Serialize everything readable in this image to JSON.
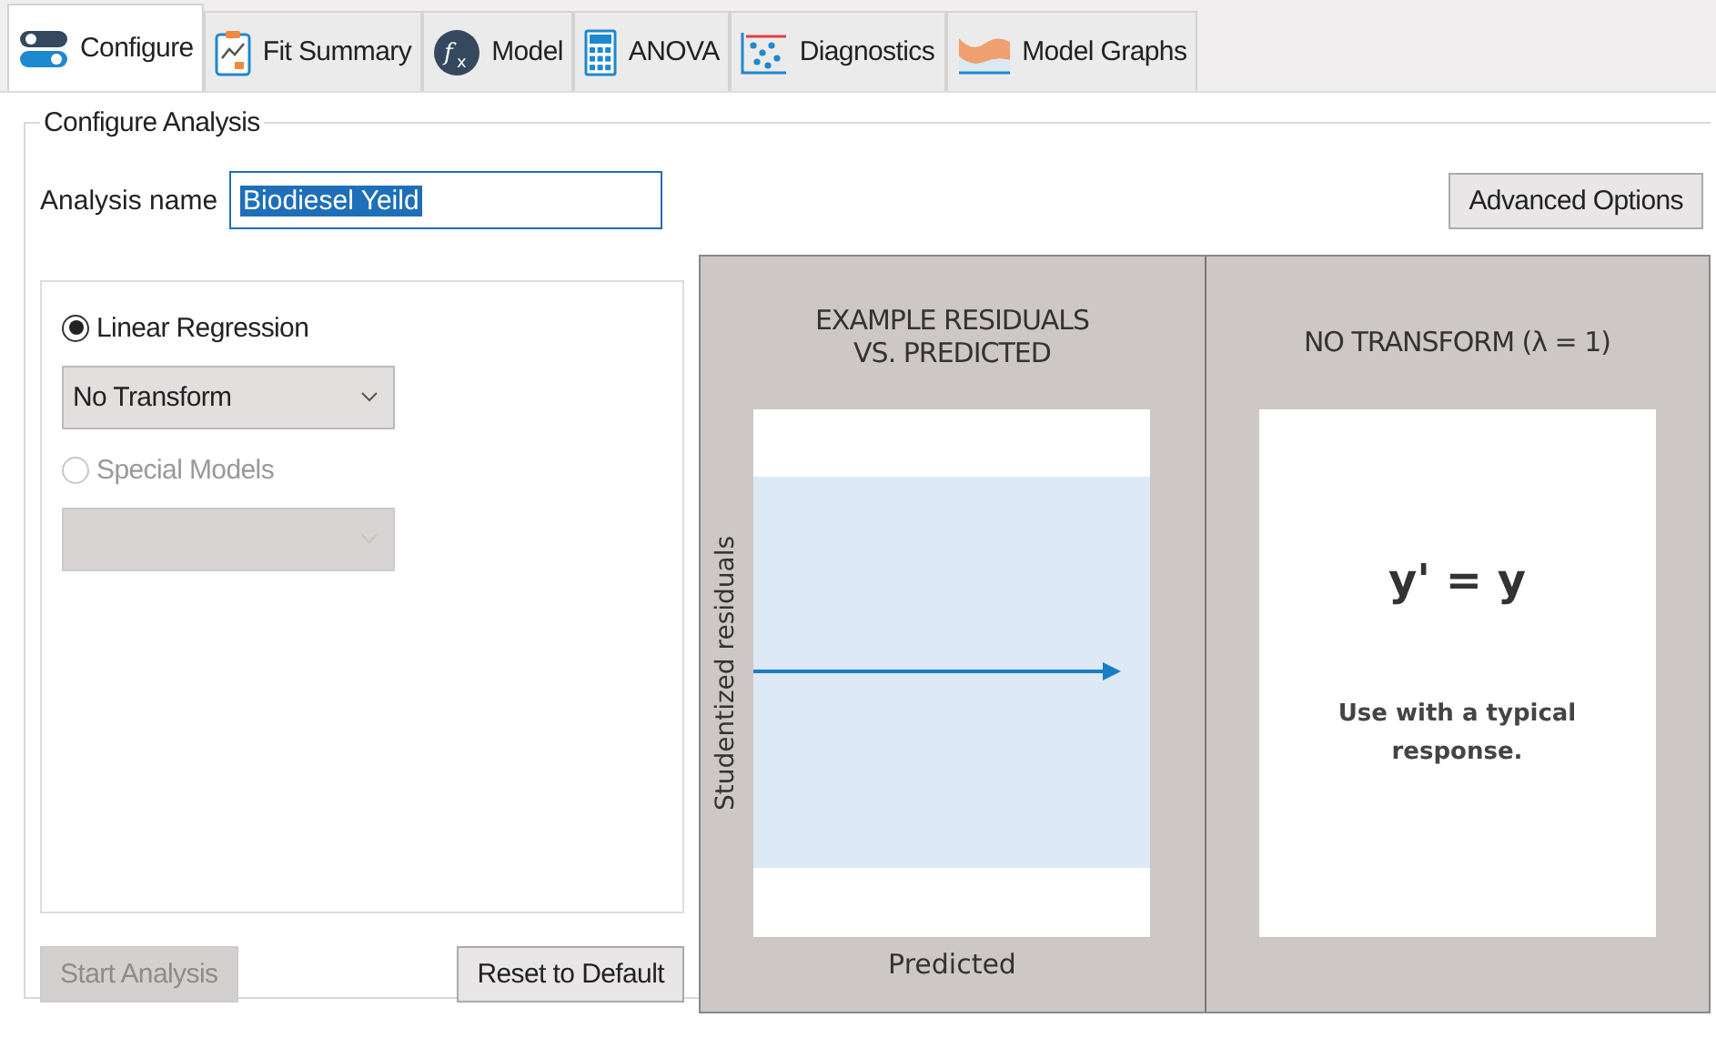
{
  "tabs": [
    {
      "label": "Configure",
      "kind": "toggle",
      "selected": true
    },
    {
      "label": "Fit Summary",
      "kind": "clipboard",
      "selected": false
    },
    {
      "label": "Model",
      "kind": "fx",
      "selected": false
    },
    {
      "label": "ANOVA",
      "kind": "calculator",
      "selected": false
    },
    {
      "label": "Diagnostics",
      "kind": "scatter",
      "selected": false
    },
    {
      "label": "Model Graphs",
      "kind": "surface",
      "selected": false
    }
  ],
  "group": {
    "title": "Configure Analysis",
    "analysis_name": {
      "label": "Analysis name",
      "value": "Biodiesel Yeild"
    },
    "advanced_button": "Advanced Options",
    "options": [
      {
        "label": "Linear Regression",
        "selected": true,
        "disabled": false,
        "dropdown": {
          "value": "No Transform",
          "disabled": false
        }
      },
      {
        "label": "Special Models",
        "selected": false,
        "disabled": true,
        "dropdown": {
          "disabled": true
        }
      }
    ],
    "start_button": {
      "label": "Start Analysis",
      "disabled": true
    },
    "reset_button": {
      "label": "Reset to Default",
      "disabled": false
    },
    "example": {
      "title_lines": [
        "EXAMPLE RESIDUALS",
        "VS. PREDICTED"
      ],
      "ylabel": "Studentized residuals",
      "xlabel": "Predicted"
    },
    "transform": {
      "title": "NO TRANSFORM (λ = 1)",
      "formula": "y' = y",
      "note": "Use with a typical response."
    }
  }
}
